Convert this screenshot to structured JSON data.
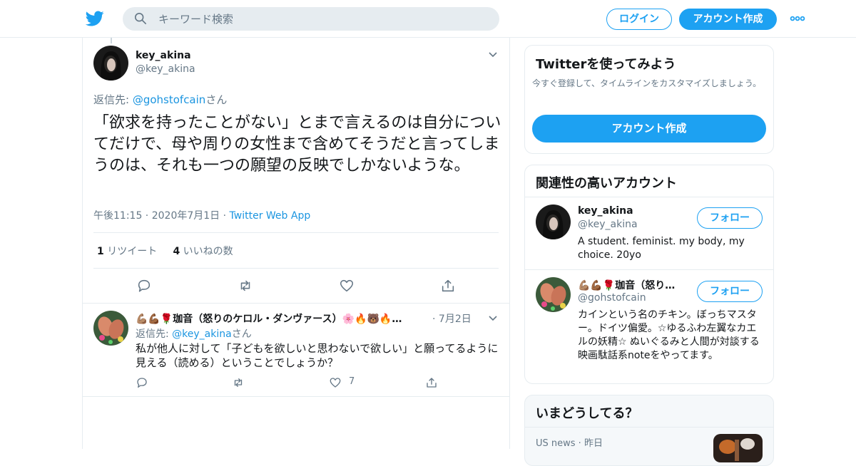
{
  "header": {
    "search_placeholder": "キーワード検索",
    "login_label": "ログイン",
    "signup_label": "アカウント作成"
  },
  "tweet": {
    "name": "key_akina",
    "handle": "@key_akina",
    "reply_prefix": "返信先: ",
    "reply_handle": "@gohstofcain",
    "reply_suffix": "さん",
    "text": "「欲求を持ったことがない」とまで言えるのは自分についてだけで、母や周りの女性まで含めてそうだと言ってしまうのは、それも一つの願望の反映でしかないような。",
    "time": "午後11:15",
    "date": "2020年7月1日",
    "source": "Twitter Web App",
    "separator": " · ",
    "retweets_count": "1",
    "retweets_label": "リツイート",
    "likes_count": "4",
    "likes_label": "いいねの数"
  },
  "reply": {
    "name": "💪🏽💪🏾🌹珈音（怒りのケロル・ダンヴァース）🌸🔥🐻🔥…",
    "date": "7月2日",
    "reply_prefix": "返信先: ",
    "reply_handle": "@key_akina",
    "reply_suffix": "さん",
    "text": "私が他人に対して「子どもを欲しいと思わないで欲しい」と願ってるように見える（読める）ということでしょうか？",
    "like_count": "7"
  },
  "sidebar": {
    "try_title": "Twitterを使ってみよう",
    "try_sub": "今すぐ登録して、タイムラインをカスタマイズしましょう。",
    "try_button": "アカウント作成",
    "related_title": "関連性の高いアカウント",
    "follow_label": "フォロー",
    "accounts": [
      {
        "name": "key_akina",
        "handle": "@key_akina",
        "bio": "A student. feminist. my body, my choice. 20yo"
      },
      {
        "name": "💪🏽💪🏾🌹珈音（怒り…",
        "handle": "@gohstofcain",
        "bio": "カインという名のチキン。ぼっちマスター。ドイツ偏愛。☆ゆるふわ左翼なカエルの妖精☆ ぬいぐるみと人間が対談する映画駄話系noteをやってます。"
      }
    ],
    "trends_title": "いまどうしてる？",
    "trend_category": "US news",
    "trend_time": "昨日"
  },
  "colors": {
    "brand": "#1da1f2",
    "link": "#1b95e0",
    "secondary_text": "#657786",
    "border": "#e6ecf0"
  },
  "icons": [
    "twitter-bird-icon",
    "search-icon",
    "more-icon",
    "chevron-down-icon",
    "reply-icon",
    "retweet-icon",
    "like-icon",
    "share-icon"
  ]
}
